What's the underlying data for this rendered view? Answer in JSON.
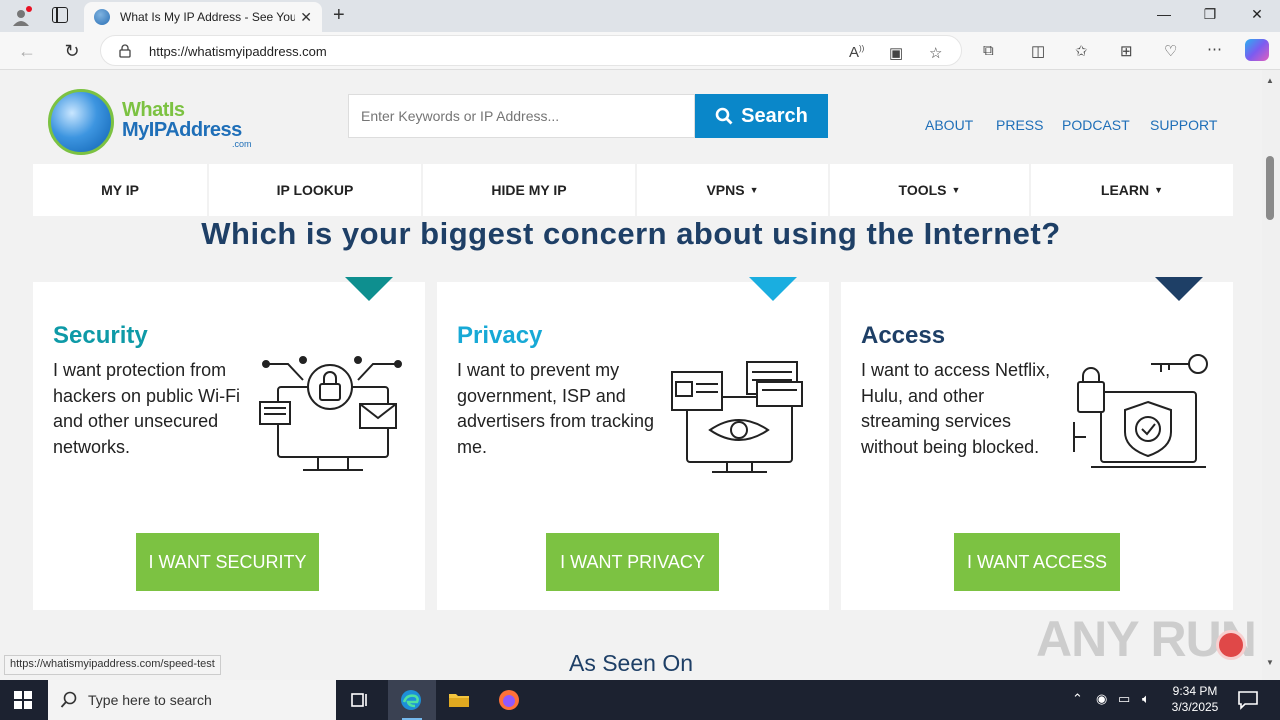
{
  "browser": {
    "tab_title": "What Is My IP Address - See Your",
    "url": "https://whatismyipaddress.com",
    "status_url": "https://whatismyipaddress.com/speed-test"
  },
  "site": {
    "logo": {
      "line1": "WhatIs",
      "line2": "MyIPAddress",
      "line3": ".com"
    },
    "search": {
      "placeholder": "Enter Keywords or IP Address...",
      "button_label": "Search"
    },
    "top_links": [
      "ABOUT",
      "PRESS",
      "PODCAST",
      "SUPPORT"
    ],
    "menu": [
      {
        "label": "MY IP",
        "caret": ""
      },
      {
        "label": "IP LOOKUP",
        "caret": ""
      },
      {
        "label": "HIDE MY IP",
        "caret": ""
      },
      {
        "label": "VPNS",
        "caret": "▼"
      },
      {
        "label": "TOOLS",
        "caret": "▼"
      },
      {
        "label": "LEARN",
        "caret": "▼"
      }
    ],
    "headline": "Which is your biggest concern about using the Internet?",
    "cards": [
      {
        "title": "Security",
        "description": "I want protection from hackers on public Wi-Fi and other unsecured networks.",
        "button": "I WANT SECURITY",
        "color": "#0e9aa7",
        "tri_color": "#0e8f8f"
      },
      {
        "title": "Privacy",
        "description": "I want to prevent my government, ISP and advertisers from tracking me.",
        "button": "I WANT PRIVACY",
        "color": "#17a9d6",
        "tri_color": "#1aaee0"
      },
      {
        "title": "Access",
        "description": "I want to access Netflix, Hulu, and other streaming services without being blocked.",
        "button": "I WANT ACCESS",
        "color": "#1e3f66",
        "tri_color": "#1e3f66"
      }
    ],
    "as_seen_on": "As Seen On",
    "watermark": "ANY RUN"
  },
  "taskbar": {
    "search_placeholder": "Type here to search",
    "time": "9:34 PM",
    "date": "3/3/2025"
  },
  "colors": {
    "accent_blue": "#0a87c9",
    "green": "#7cc242",
    "navy": "#1e3f66"
  }
}
